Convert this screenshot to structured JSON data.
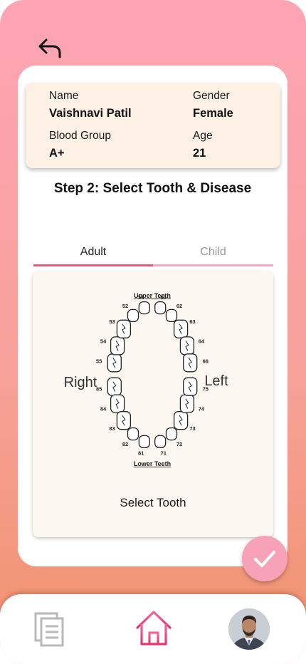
{
  "header": {
    "back_icon": "back-arrow-icon"
  },
  "patient": {
    "name_label": "Name",
    "name_value": "Vaishnavi Patil",
    "gender_label": "Gender",
    "gender_value": "Female",
    "blood_label": "Blood Group",
    "blood_value": "A+",
    "age_label": "Age",
    "age_value": "21"
  },
  "step": {
    "title": "Step 2: Select Tooth & Disease"
  },
  "tabs": [
    {
      "label": "Adult",
      "active": true
    },
    {
      "label": "Child",
      "active": false
    }
  ],
  "tooth_chart": {
    "upper_label": "Upper Teeth",
    "lower_label": "Lower Teeth",
    "right_label": "Right",
    "left_label": "Left",
    "upper_numbers": [
      "55",
      "54",
      "53",
      "52",
      "51",
      "61",
      "62",
      "63",
      "64",
      "66"
    ],
    "lower_numbers": [
      "85",
      "84",
      "83",
      "82",
      "81",
      "71",
      "72",
      "73",
      "74",
      "75"
    ],
    "prompt": "Select Tooth"
  },
  "actions": {
    "confirm_icon": "check-icon"
  },
  "bottom_nav": {
    "items": [
      {
        "name": "documents",
        "icon": "documents-icon"
      },
      {
        "name": "home",
        "icon": "home-icon",
        "active": true
      },
      {
        "name": "profile",
        "icon": "avatar"
      }
    ]
  },
  "colors": {
    "accent_pink": "#e9587f",
    "fab_pink": "#f7a2b8",
    "gradient_top": "#fda4b5",
    "gradient_bottom": "#f1926c",
    "patient_card_bg": "#fdf1e6"
  }
}
